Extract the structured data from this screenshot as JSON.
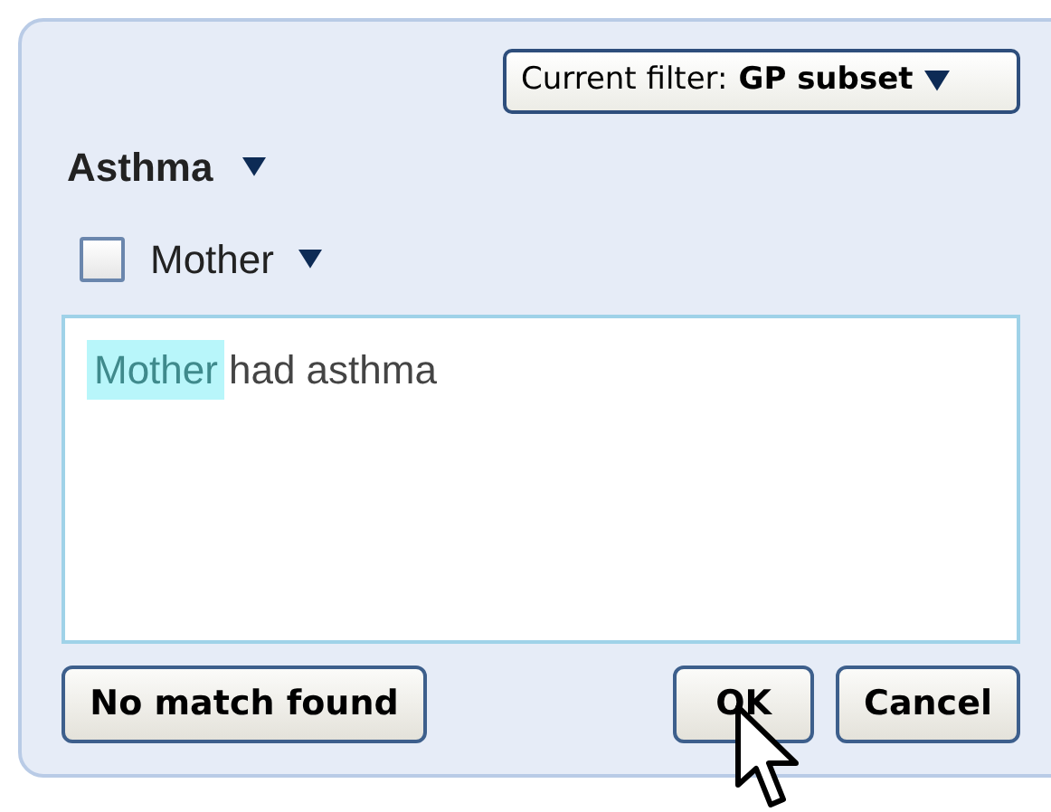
{
  "filter_button": {
    "label": "Current filter:",
    "value": "GP subset"
  },
  "category": {
    "label": "Asthma"
  },
  "relation": {
    "label": "Mother",
    "checked": false
  },
  "text_box": {
    "segments": [
      {
        "text": "Mother",
        "highlighted": true
      },
      {
        "text": "had asthma",
        "highlighted": false
      }
    ]
  },
  "buttons": [
    {
      "label": "No match found"
    },
    {
      "label": "OK"
    },
    {
      "label": "Cancel"
    }
  ]
}
